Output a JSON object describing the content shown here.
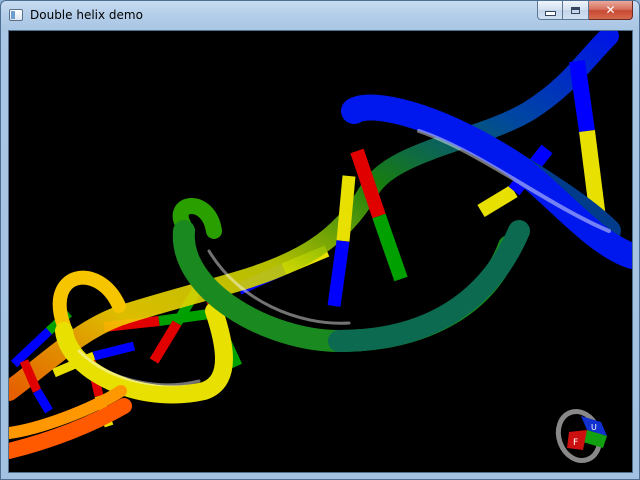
{
  "window": {
    "title": "Double helix demo",
    "icon": "app-window-icon",
    "buttons": {
      "minimize_icon": "minimize-icon",
      "maximize_icon": "maximize-icon",
      "close_glyph": "✕"
    }
  },
  "scene": {
    "background_color": "#000000",
    "base_pair_colors": [
      "#e00000",
      "#00a000",
      "#0000ff",
      "#f0e000"
    ],
    "strand_gradient": [
      "#ff2a00",
      "#ff9a00",
      "#e8e000",
      "#2aa000",
      "#006a40",
      "#004a9a",
      "#0010ff"
    ]
  },
  "view_cube": {
    "front_label": "F",
    "top_label": "U",
    "front_color": "#cc1010",
    "top_color": "#1030d0",
    "side_color": "#10a010",
    "ring_color": "#888888"
  }
}
